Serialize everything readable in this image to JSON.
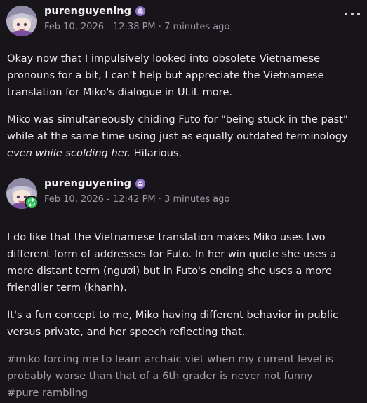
{
  "posts": [
    {
      "username": "purenguyening",
      "timestamp": "Feb 10, 2026 - 12:38 PM",
      "relative_time": "7 minutes ago",
      "is_repost": false,
      "paragraph_1": "Okay now that I impulsively looked into obsolete Vietnamese pronouns for a bit, I can't help but appreciate the Vietnamese translation for Miko's dialogue in ULiL more.",
      "paragraph_2_plain": "Miko was simultaneously chiding Futo for \"being stuck in the past\" while at the same time using just as equally outdated terminology ",
      "paragraph_2_em": "even while scolding her.",
      "paragraph_2_tail": " Hilarious."
    },
    {
      "username": "purenguyening",
      "timestamp": "Feb 10, 2026 - 12:42 PM",
      "relative_time": "3 minutes ago",
      "is_repost": true,
      "paragraph_1": "I do like that the Vietnamese translation makes Miko uses two different form of addresses for Futo. In her win quote she uses a more distant term (ngươi) but in Futo's ending she uses a more friendlier term (khanh).",
      "paragraph_2": "It's a fun concept to me, Miko having different behavior in public versus private, and her speech reflecting that.",
      "tags": [
        "#miko forcing me to learn archaic viet when my current level is probably worse than that of a 6th grader is never not funny",
        "#pure rambling"
      ]
    }
  ],
  "meta_separator": " · ",
  "colors": {
    "background": "#17151a",
    "text": "#ece9ee",
    "muted": "#9d98a4",
    "repost_green": "#2fbf5a",
    "badge_purple": "#8b6fc9"
  },
  "icons": {
    "more": "more-horizontal-icon",
    "repost": "repost-icon",
    "user_badge": "ghost-badge-icon"
  }
}
